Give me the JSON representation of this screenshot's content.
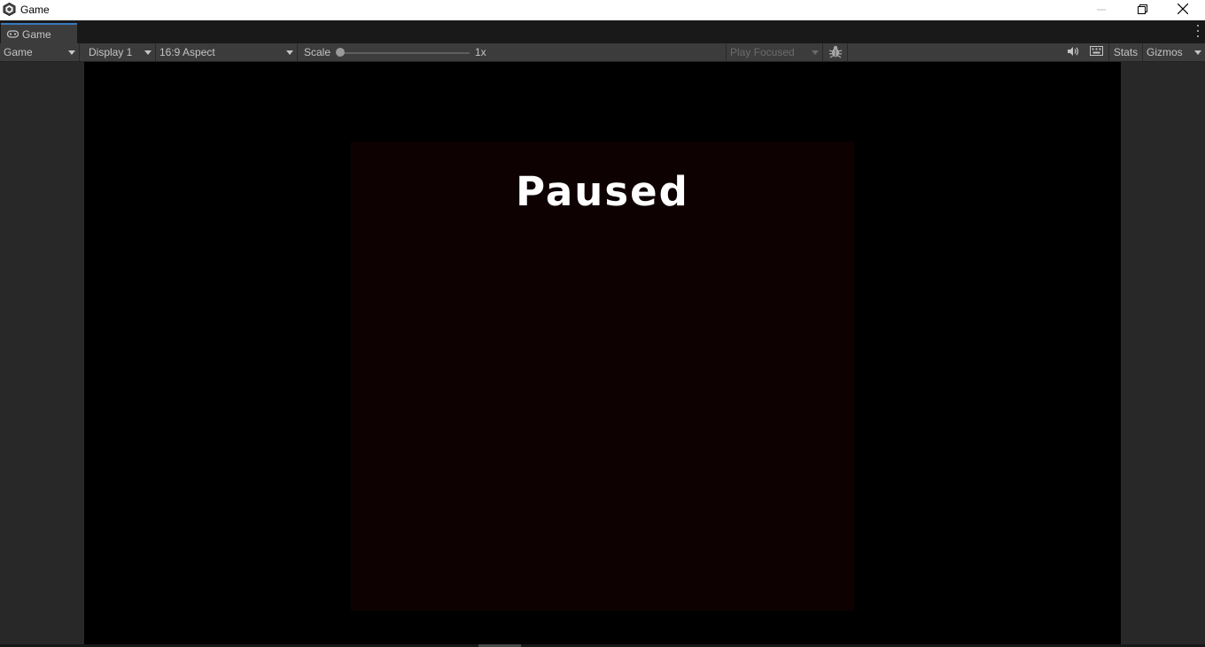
{
  "window": {
    "title": "Game"
  },
  "tab": {
    "label": "Game"
  },
  "toolbar": {
    "view_mode": "Game",
    "display": "Display 1",
    "aspect": "16:9 Aspect",
    "scale_label": "Scale",
    "scale_value": "1x",
    "scale_fraction": 0.0,
    "play_mode": "Play Focused",
    "stats_label": "Stats",
    "gizmos_label": "Gizmos"
  },
  "game": {
    "pause_title": "Paused"
  },
  "colors": {
    "accent": "#3a79bb",
    "panel_background": "#0e0101",
    "game_background": "#000000",
    "editor_background": "#282828"
  },
  "icons": [
    "unity-logo-icon",
    "gamepad-icon",
    "minimize-icon",
    "maximize-icon",
    "close-icon",
    "kebab-menu-icon",
    "bug-icon",
    "audio-icon",
    "keyboard-icon",
    "dropdown-arrow-icon"
  ]
}
